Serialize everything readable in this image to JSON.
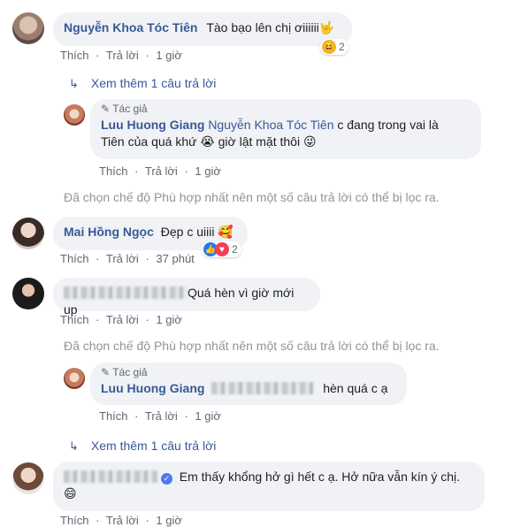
{
  "colors": {
    "link": "#385898",
    "bubble": "#f0f2f5",
    "muted": "#606770",
    "note": "#90949c"
  },
  "actions": {
    "like": "Thích",
    "reply": "Trả lời",
    "dot": "·"
  },
  "c1": {
    "name": "Nguyễn Khoa Tóc Tiên",
    "text": "Tào bạo lên chị ơiiiiii",
    "emoji": "🤟",
    "time": "1 giờ",
    "react_count": "2",
    "react_icon": "haha-icon"
  },
  "more1": {
    "label": "Xem thêm 1 câu trả lời"
  },
  "r1": {
    "badge": "Tác giả",
    "name": "Luu Huong Giang",
    "mention": "Nguyễn Khoa Tóc Tiên",
    "text1": " c đang trong vai là",
    "text2": "Tiên của quá khứ ",
    "emoji1": "😭",
    "text3": " giờ lật mặt thôi ",
    "emoji2": "😜",
    "time": "1 giờ"
  },
  "note1": "Đã chọn chế độ Phù hợp nhất nên một số câu trả lời có thể bị lọc ra.",
  "c2": {
    "name": "Mai Hồng Ngọc",
    "text": "Đẹp c uiiii ",
    "emoji": "🥰",
    "time": "37 phút",
    "react_count": "2"
  },
  "c3": {
    "text": "Quá hèn vì giờ mới up",
    "time": "1 giờ"
  },
  "note2": "Đã chọn chế độ Phù hợp nhất nên một số câu trả lời có thể bị lọc ra.",
  "r2": {
    "badge": "Tác giả",
    "name": "Luu Huong Giang",
    "text": "hèn quá c ạ",
    "time": "1 giờ"
  },
  "more2": {
    "label": "Xem thêm 1 câu trả lời"
  },
  "c4": {
    "text": "Em thấy khổng hở gì hết c ạ. Hở nữa vẫn kín ý chị.",
    "emoji": "😄",
    "time": "1 giờ"
  }
}
